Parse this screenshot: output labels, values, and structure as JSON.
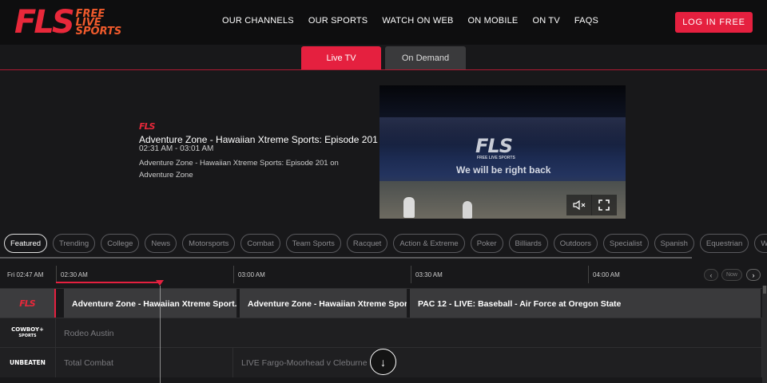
{
  "header": {
    "logo_big": "FLS",
    "logo_lines": [
      "FREE",
      "LIVE",
      "SPORTS"
    ],
    "nav": [
      "OUR CHANNELS",
      "OUR SPORTS",
      "WATCH ON WEB",
      "ON MOBILE",
      "ON TV",
      "FAQS"
    ],
    "login_label": "LOG IN FREE"
  },
  "tabs": {
    "live": "Live TV",
    "on_demand": "On Demand"
  },
  "feature": {
    "channel_logo": "FLS",
    "channel_logo_sub": "FREE LIVE SPORTS",
    "title": "Adventure Zone - Hawaiian Xtreme Sports: Episode 201",
    "time": "02:31 AM - 03:01 AM",
    "description": "Adventure Zone - Hawaiian Xtreme Sports: Episode 201 on Adventure Zone",
    "video_logo": "FLS",
    "video_logo_sub": "FREE LIVE SPORTS",
    "video_message": "We will be right back",
    "mute_icon": "mute-icon",
    "fullscreen_icon": "fullscreen-icon"
  },
  "categories": [
    "Featured",
    "Trending",
    "College",
    "News",
    "Motorsports",
    "Combat",
    "Team Sports",
    "Racquet",
    "Action & Extreme",
    "Poker",
    "Billiards",
    "Outdoors",
    "Specialist",
    "Spanish",
    "Equestrian",
    "Wellness"
  ],
  "guide": {
    "current_time": "Fri 02:47 AM",
    "slots": [
      "02:30 AM",
      "03:00 AM",
      "03:30 AM",
      "04:00 AM"
    ],
    "now_button": "Now",
    "prev_icon": "chevron-left-icon",
    "next_icon": "chevron-right-icon",
    "rows": [
      {
        "channel": "FLS",
        "channel_sub": "FREE LIVE SPORTS",
        "programs": [
          "Adventure Zone - Hawaiian Xtreme Sport...",
          "Adventure Zone - Hawaiian Xtreme Spor...",
          "PAC 12 - LIVE: Baseball - Air Force at Oregon State"
        ]
      },
      {
        "channel": "COWBOY+",
        "channel_sub": "SPORTS",
        "programs": [
          "Rodeo Austin"
        ]
      },
      {
        "channel": "UNBEATEN",
        "channel_sub": "",
        "programs": [
          "Total Combat",
          "LIVE Fargo-Moorhead v Cleburne"
        ]
      }
    ]
  },
  "colors": {
    "accent": "#e5203f",
    "logo_red": "#e8283a",
    "logo_orange": "#f05a2c",
    "background": "#18181a"
  }
}
